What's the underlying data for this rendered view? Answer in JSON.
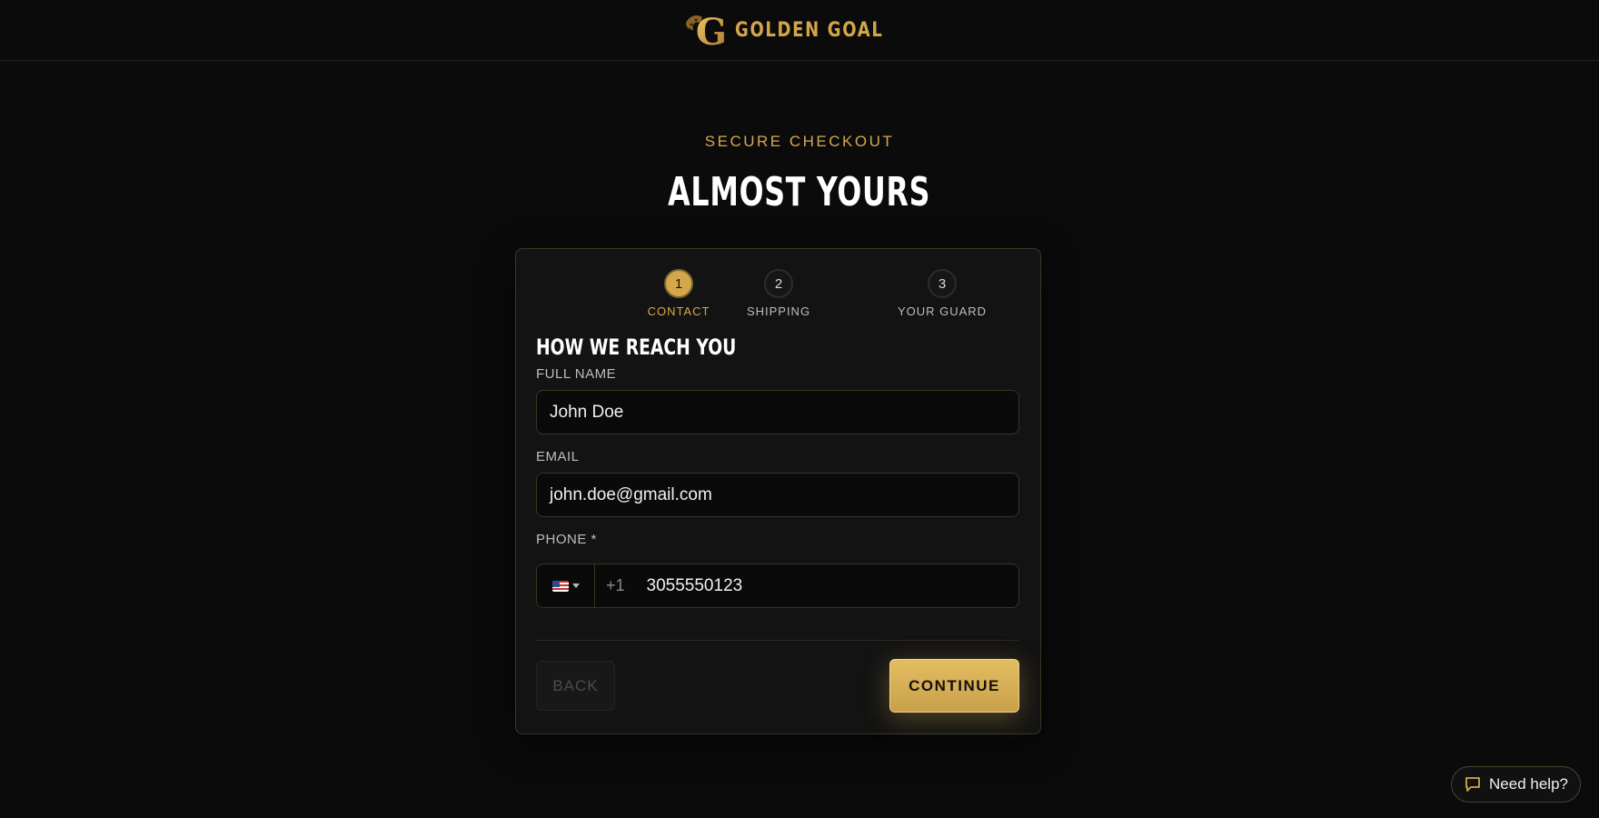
{
  "header": {
    "brand_name": "GOLDEN GOAL",
    "logo_letter": "G"
  },
  "hero": {
    "kicker": "SECURE CHECKOUT",
    "title": "ALMOST YOURS"
  },
  "steps": [
    {
      "number": "1",
      "label": "CONTACT",
      "active": true
    },
    {
      "number": "2",
      "label": "SHIPPING",
      "active": false
    },
    {
      "number": "3",
      "label": "YOUR GUARD",
      "active": false
    }
  ],
  "form": {
    "section_title": "HOW WE REACH YOU",
    "full_name": {
      "label": "FULL NAME",
      "value": "John Doe"
    },
    "email": {
      "label": "EMAIL",
      "value": "john.doe@gmail.com"
    },
    "phone": {
      "label": "PHONE *",
      "country": "US",
      "dial_code": "+1",
      "value": "3055550123"
    }
  },
  "actions": {
    "back_label": "BACK",
    "continue_label": "CONTINUE"
  },
  "help": {
    "label": "Need help?"
  },
  "colors": {
    "accent": "#d4a84a",
    "background": "#0b0b0b",
    "card": "#131313"
  }
}
